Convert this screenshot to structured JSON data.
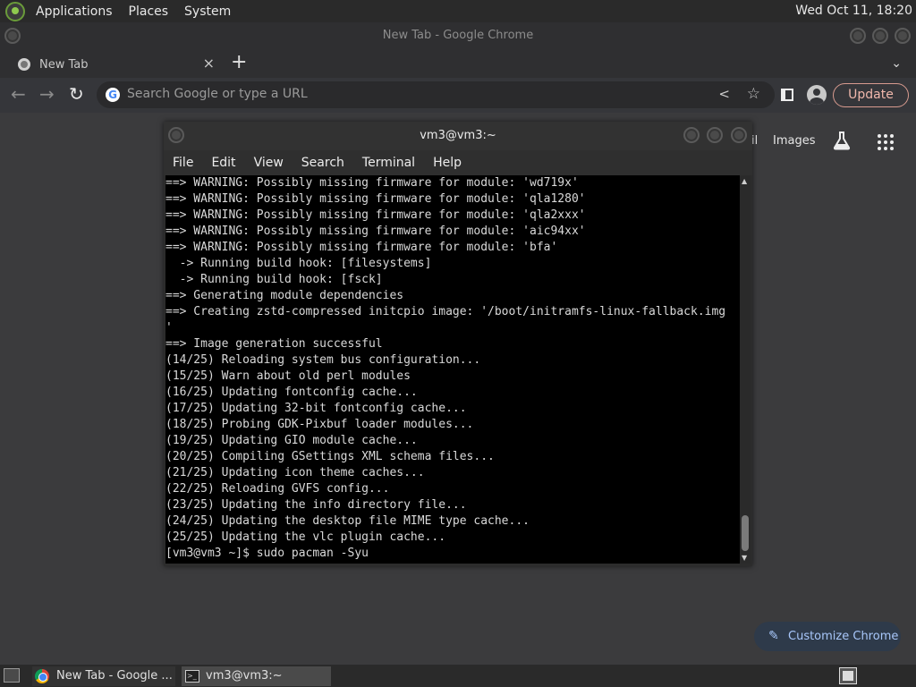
{
  "top_panel": {
    "menus": [
      "Applications",
      "Places",
      "System"
    ],
    "clock": "Wed Oct 11, 18:20"
  },
  "chrome": {
    "window_title": "New Tab - Google Chrome",
    "tab": {
      "title": "New Tab",
      "close": "×"
    },
    "new_tab": "+",
    "omnibox": {
      "placeholder": "Search Google or type a URL"
    },
    "update_label": "Update",
    "ntp": {
      "gmail_partial": "il",
      "images_label": "Images",
      "customize_label": "Customize Chrome"
    }
  },
  "terminal": {
    "title": "vm3@vm3:~",
    "menu": [
      "File",
      "Edit",
      "View",
      "Search",
      "Terminal",
      "Help"
    ],
    "lines": [
      "==> WARNING: Possibly missing firmware for module: 'wd719x'",
      "==> WARNING: Possibly missing firmware for module: 'qla1280'",
      "==> WARNING: Possibly missing firmware for module: 'qla2xxx'",
      "==> WARNING: Possibly missing firmware for module: 'aic94xx'",
      "==> WARNING: Possibly missing firmware for module: 'bfa'",
      "  -> Running build hook: [filesystems]",
      "  -> Running build hook: [fsck]",
      "==> Generating module dependencies",
      "==> Creating zstd-compressed initcpio image: '/boot/initramfs-linux-fallback.img",
      "'",
      "==> Image generation successful",
      "(14/25) Reloading system bus configuration...",
      "(15/25) Warn about old perl modules",
      "(16/25) Updating fontconfig cache...",
      "(17/25) Updating 32-bit fontconfig cache...",
      "(18/25) Probing GDK-Pixbuf loader modules...",
      "(19/25) Updating GIO module cache...",
      "(20/25) Compiling GSettings XML schema files...",
      "(21/25) Updating icon theme caches...",
      "(22/25) Reloading GVFS config...",
      "(23/25) Updating the info directory file...",
      "(24/25) Updating the desktop file MIME type cache...",
      "(25/25) Updating the vlc plugin cache...",
      "[vm3@vm3 ~]$ sudo pacman -Syu"
    ]
  },
  "taskbar": {
    "chrome_task": "New Tab - Google ...",
    "terminal_task": "vm3@vm3:~"
  },
  "colors": {
    "accent_update": "#f0b8ac",
    "customize_text": "#a8c7fa",
    "terminal_bg": "#000000"
  }
}
